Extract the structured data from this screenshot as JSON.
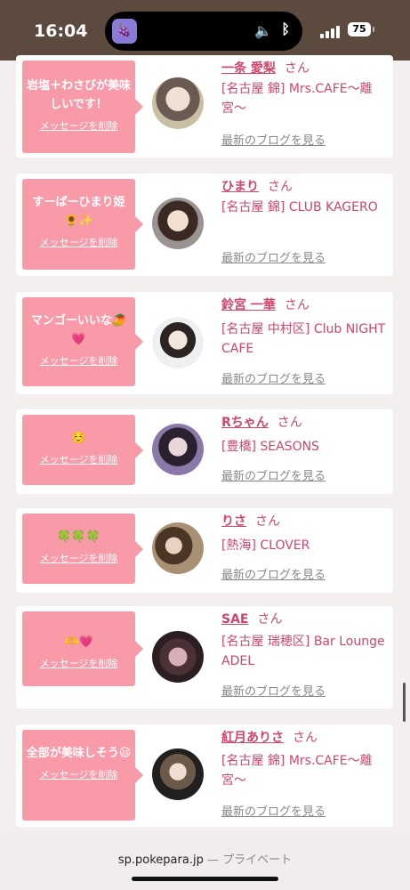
{
  "status_bar": {
    "time": "16:04",
    "battery": "75"
  },
  "island": {
    "app_icon": "app-icon"
  },
  "delete_label": "メッセージを削除",
  "san": "さん",
  "blog_label": "最新のブログを見る",
  "cards": [
    {
      "message": "岩塩＋わさびが美味しいです！",
      "name": "一条 愛梨",
      "shop": "[名古屋 錦] Mrs.CAFE〜離宮〜"
    },
    {
      "message": "すーぱーひまり姫🌻✨",
      "name": "ひまり",
      "shop": "[名古屋 錦] CLUB KAGERO"
    },
    {
      "message": "マンゴーいいな🥭💗",
      "name": "鈴宮 一華",
      "shop": "[名古屋 中村区] Club NIGHT CAFE"
    },
    {
      "message": "☺️",
      "name": "Rちゃん",
      "shop": "[豊橋] SEASONS"
    },
    {
      "message": "🍀🍀🍀",
      "name": "りさ",
      "shop": "[熱海] CLOVER"
    },
    {
      "message": "🫶💗",
      "name": "SAE",
      "shop": "[名古屋 瑞穂区] Bar Lounge ADEL"
    },
    {
      "message": "全部が美味しそう😃",
      "name": "紅月ありさ",
      "shop": "[名古屋 錦] Mrs.CAFE〜離宮〜"
    }
  ],
  "address_bar": {
    "domain": "sp.pokepara.jp",
    "separator": "—",
    "mode": "プライベート"
  }
}
